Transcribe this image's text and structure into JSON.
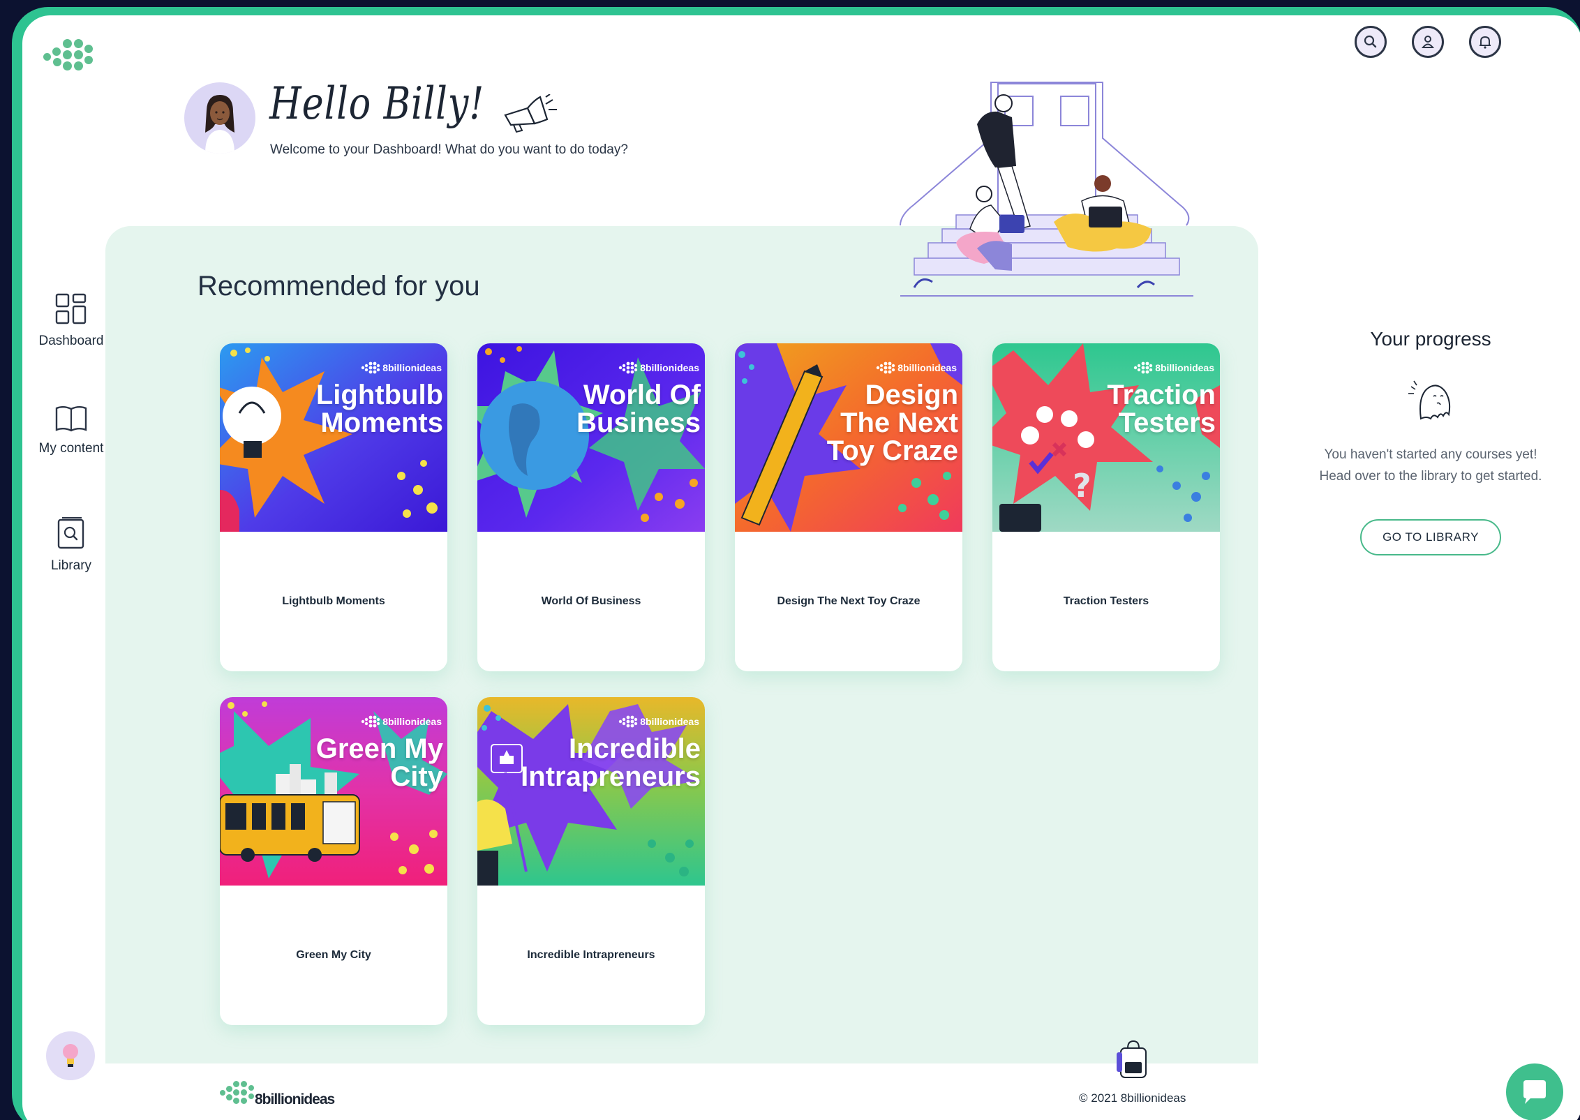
{
  "greeting": {
    "hello": "Hello Billy!",
    "welcome": "Welcome to your Dashboard! What do you want to do today?"
  },
  "nav": {
    "items": [
      {
        "label": "Dashboard",
        "icon": "dashboard-grid-icon"
      },
      {
        "label": "My content",
        "icon": "open-book-icon"
      },
      {
        "label": "Library",
        "icon": "library-search-icon"
      }
    ]
  },
  "header_icons": [
    "search-icon",
    "user-icon",
    "bell-icon"
  ],
  "recommended": {
    "title": "Recommended for you",
    "brand": "8billionideas",
    "cards": [
      {
        "headline_1": "Lightbulb",
        "headline_2": "Moments",
        "headline_3": "",
        "caption": "Lightbulb Moments"
      },
      {
        "headline_1": "World Of",
        "headline_2": "Business",
        "headline_3": "",
        "caption": "World Of Business"
      },
      {
        "headline_1": "Design",
        "headline_2": "The Next",
        "headline_3": "Toy Craze",
        "caption": "Design The Next Toy Craze"
      },
      {
        "headline_1": "Traction",
        "headline_2": "Testers",
        "headline_3": "",
        "caption": "Traction Testers"
      },
      {
        "headline_1": "Green My",
        "headline_2": "City",
        "headline_3": "",
        "caption": "Green My City"
      },
      {
        "headline_1": "Incredible",
        "headline_2": "Intrapreneurs",
        "headline_3": "",
        "caption": "Incredible Intrapreneurs"
      }
    ]
  },
  "progress": {
    "title": "Your progress",
    "message": "You haven't started any courses yet! Head over to the library to get started.",
    "button": "GO TO LIBRARY"
  },
  "footer": {
    "brand": "8billionideas",
    "copyright": "© 2021 8billionideas"
  },
  "colors": {
    "frame": "#2ec391",
    "panel": "#e5f5ee",
    "accent": "#48b98a",
    "text": "#1d2b3a"
  }
}
